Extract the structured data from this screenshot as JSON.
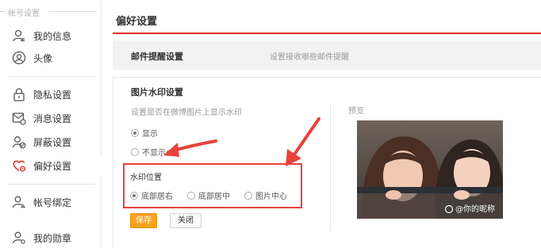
{
  "sidebar": {
    "section_title": "帐号设置",
    "items": [
      {
        "label": "我的信息",
        "icon": "user-info-icon"
      },
      {
        "label": "头像",
        "icon": "avatar-icon"
      },
      {
        "label": "隐私设置",
        "icon": "lock-icon"
      },
      {
        "label": "消息设置",
        "icon": "message-icon"
      },
      {
        "label": "屏蔽设置",
        "icon": "block-icon"
      },
      {
        "label": "偏好设置",
        "icon": "heart-settings-icon",
        "active": true
      },
      {
        "label": "帐号绑定",
        "icon": "account-bind-icon"
      },
      {
        "label": "我的勋章",
        "icon": "medal-icon"
      }
    ]
  },
  "main": {
    "title": "偏好设置",
    "mail_reminder": {
      "title": "邮件提醒设置",
      "description": "设置接收哪些邮件提醒"
    },
    "watermark": {
      "title": "图片水印设置",
      "question": "设置是否在微博图片上显示水印",
      "options": [
        {
          "label": "显示",
          "checked": true
        },
        {
          "label": "不显示",
          "checked": false
        }
      ],
      "position": {
        "title": "水印位置",
        "options": [
          {
            "label": "底部居右",
            "checked": true
          },
          {
            "label": "底部居中",
            "checked": false
          },
          {
            "label": "图片中心",
            "checked": false
          }
        ]
      },
      "save_label": "保存",
      "close_label": "关闭",
      "preview_label": "预览",
      "preview_watermark": "@你的昵称"
    }
  },
  "colors": {
    "accent_red": "#e0312f",
    "save_orange": "#f8a21d",
    "annotation_red": "#e8413a"
  }
}
